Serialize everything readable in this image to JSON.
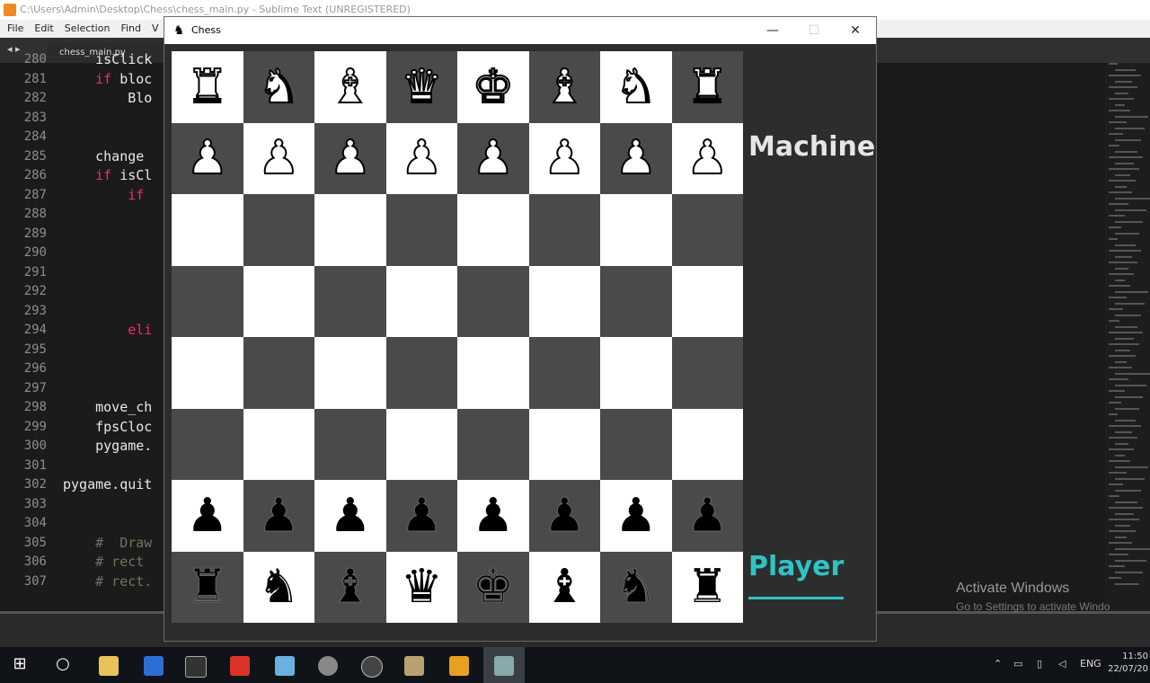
{
  "editor": {
    "title": "C:\\Users\\Admin\\Desktop\\Chess\\chess_main.py - Sublime Text (UNREGISTERED)",
    "menu": [
      "File",
      "Edit",
      "Selection",
      "Find",
      "V"
    ],
    "tab_label": "chess_main.py",
    "line_numbers": [
      "280",
      "281",
      "282",
      "283",
      "284",
      "285",
      "286",
      "287",
      "288",
      "289",
      "290",
      "291",
      "292",
      "293",
      "294",
      "295",
      "296",
      "297",
      "298",
      "299",
      "300",
      "301",
      "302",
      "303",
      "304",
      "305",
      "306",
      "307"
    ],
    "code_lines": [
      {
        "indent": "    ",
        "text": "isClick"
      },
      {
        "indent": "    ",
        "kw": "if",
        "text": " bloc"
      },
      {
        "indent": "        ",
        "text": "Blo"
      },
      {
        "indent": "",
        "text": ""
      },
      {
        "indent": "",
        "text": ""
      },
      {
        "indent": "    ",
        "text": "change"
      },
      {
        "indent": "    ",
        "kw": "if",
        "text": " isCl"
      },
      {
        "indent": "        ",
        "kw": "if",
        "text": ""
      },
      {
        "indent": "",
        "text": ""
      },
      {
        "indent": "",
        "text": ""
      },
      {
        "indent": "",
        "text": ""
      },
      {
        "indent": "",
        "text": ""
      },
      {
        "indent": "",
        "text": ""
      },
      {
        "indent": "",
        "text": ""
      },
      {
        "indent": "        ",
        "kw": "eli",
        "text": ""
      },
      {
        "indent": "",
        "text": ""
      },
      {
        "indent": "",
        "text": ""
      },
      {
        "indent": "",
        "text": ""
      },
      {
        "indent": "    ",
        "text": "move_ch"
      },
      {
        "indent": "    ",
        "text": "fpsCloc"
      },
      {
        "indent": "    ",
        "text": "pygame."
      },
      {
        "indent": "",
        "text": ""
      },
      {
        "indent": "",
        "text": "pygame.quit"
      },
      {
        "indent": "",
        "text": ""
      },
      {
        "indent": "",
        "text": ""
      },
      {
        "indent": "    ",
        "cm": "#  Draw",
        "text": ""
      },
      {
        "indent": "    ",
        "cm": "# rect",
        "text": ""
      },
      {
        "indent": "    ",
        "cm": "# rect.",
        "text": ""
      }
    ],
    "watermark_title": "Activate Windows",
    "watermark_sub": "Go to Settings to activate Windo"
  },
  "chess_window": {
    "title": "Chess",
    "minimize": "—",
    "maximize": "☐",
    "close": "✕",
    "machine_label": "Machine",
    "player_label": "Player",
    "board": [
      [
        "♜",
        "♞",
        "♝",
        "♛",
        "♚",
        "♝",
        "♞",
        "♜"
      ],
      [
        "♟",
        "♟",
        "♟",
        "♟",
        "♟",
        "♟",
        "♟",
        "♟"
      ],
      [
        "",
        "",
        "",
        "",
        "",
        "",
        "",
        ""
      ],
      [
        "",
        "",
        "",
        "",
        "",
        "",
        "",
        ""
      ],
      [
        "",
        "",
        "",
        "",
        "",
        "",
        "",
        ""
      ],
      [
        "",
        "",
        "",
        "",
        "",
        "",
        "",
        ""
      ],
      [
        "♟",
        "♟",
        "♟",
        "♟",
        "♟",
        "♟",
        "♟",
        "♟"
      ],
      [
        "♜",
        "♞",
        "♝",
        "♛",
        "♚",
        "♝",
        "♞",
        "♜"
      ]
    ],
    "piece_color_by_row": [
      "white",
      "white",
      "",
      "",
      "",
      "",
      "black",
      "black"
    ]
  },
  "taskbar": {
    "tray_language": "ENG",
    "clock_time": "11:50",
    "clock_date": "22/07/20"
  }
}
